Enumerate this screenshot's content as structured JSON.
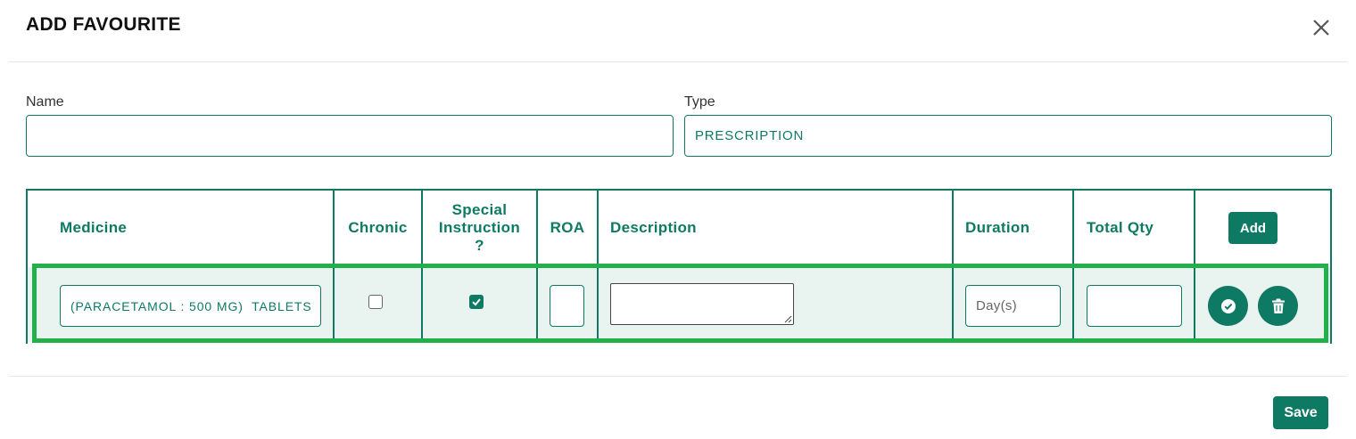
{
  "modal": {
    "title": "ADD FAVOURITE"
  },
  "form": {
    "name_label": "Name",
    "name_value": "",
    "type_label": "Type",
    "type_value": "PRESCRIPTION"
  },
  "table": {
    "headers": {
      "medicine": "Medicine",
      "chronic": "Chronic",
      "special_line1": "Special",
      "special_line2": "Instruction",
      "special_line3": "?",
      "roa": "ROA",
      "description": "Description",
      "duration": "Duration",
      "total_qty": "Total Qty"
    },
    "add_label": "Add",
    "rows": [
      {
        "medicine": "(PARACETAMOL : 500 MG)  TABLETS",
        "chronic": false,
        "special_instruction": true,
        "roa": "",
        "description": "",
        "duration_value": "",
        "duration_placeholder": "Day(s)",
        "total_qty": ""
      }
    ]
  },
  "footer": {
    "save_label": "Save"
  },
  "colors": {
    "primary": "#0f7a63",
    "row_highlight": "#22b04b",
    "row_background": "#e9f4f1"
  },
  "icons": {
    "close": "close-icon",
    "confirm": "check-circle-icon",
    "delete": "trash-icon",
    "checkbox_checked": "checkmark-icon"
  }
}
